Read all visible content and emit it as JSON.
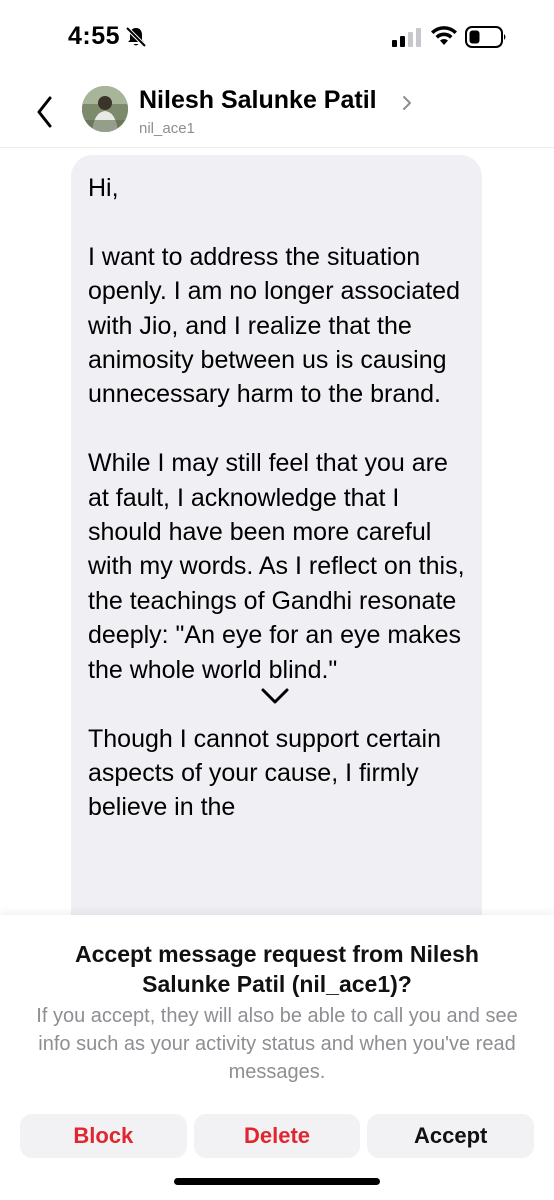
{
  "status_bar": {
    "time": "4:55",
    "icons": [
      "bell-slash-icon",
      "signal-icon",
      "wifi-icon",
      "battery-icon"
    ]
  },
  "header": {
    "name": "Nilesh Salunke Patil",
    "username": "nil_ace1",
    "icons": [
      "back-chevron-icon",
      "avatar",
      "chevron-right-icon"
    ]
  },
  "message": {
    "text": "Hi,\n\nI want to address the situation openly. I am no longer associated with Jio, and I realize that the animosity between us is causing unnecessary harm to the brand.\n\nWhile I may still feel that you are at fault, I acknowledge that I should have been more careful with my words. As I reflect on this, the teachings of Gandhi resonate deeply: \"An eye for an eye makes the whole world blind.\"\n\nThough I cannot support certain aspects of your cause, I firmly believe in the"
  },
  "request": {
    "title": "Accept message request from Nilesh Salunke Patil (nil_ace1)?",
    "description": "If you accept, they will also be able to call you and see info such as your activity status and when you've read messages.",
    "buttons": {
      "block": "Block",
      "delete": "Delete",
      "accept": "Accept"
    }
  },
  "colors": {
    "danger": "#e0262f",
    "bubble": "#efeff4",
    "secondary_text": "#8e8e93"
  }
}
